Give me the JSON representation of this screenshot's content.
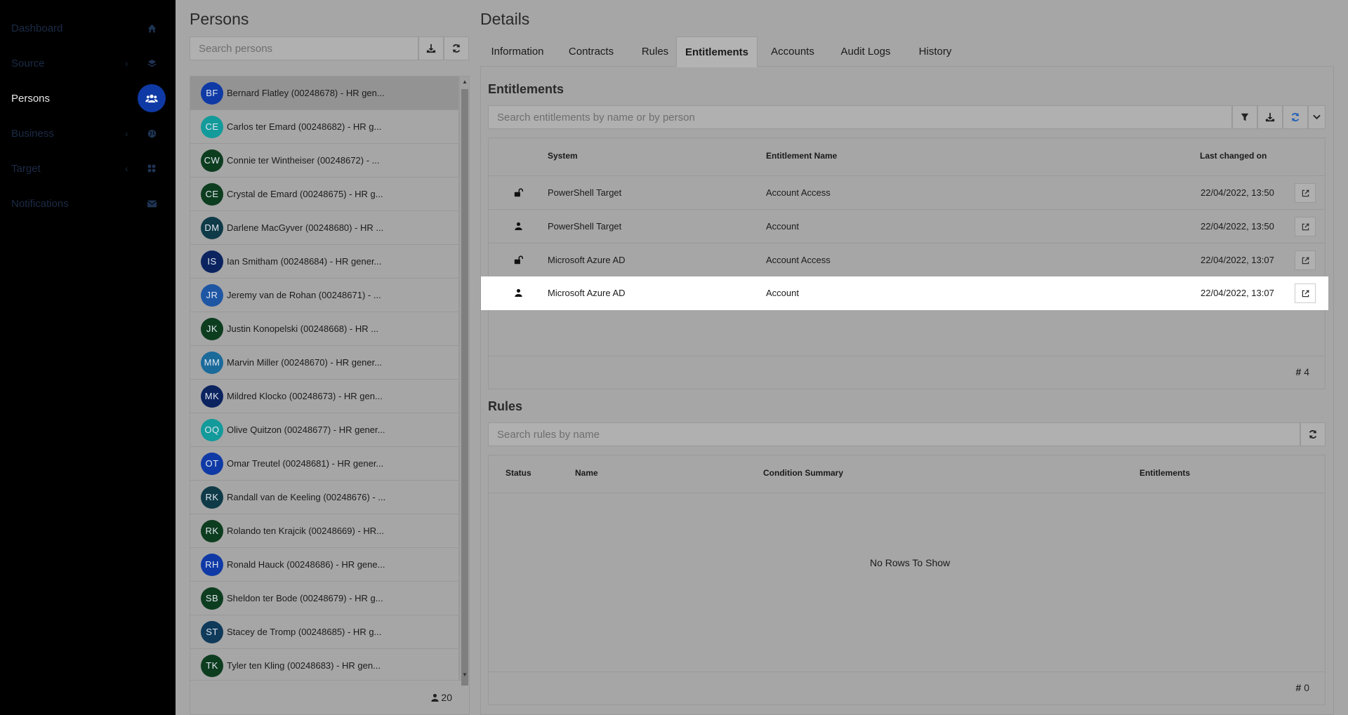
{
  "sidebar": {
    "items": [
      {
        "label": "Dashboard",
        "icon": "home-icon",
        "chevron": ""
      },
      {
        "label": "Source",
        "icon": "layers-icon",
        "chevron": "‹"
      },
      {
        "label": "Persons",
        "icon": "users-icon",
        "chevron": ""
      },
      {
        "label": "Business",
        "icon": "globe-icon",
        "chevron": "‹"
      },
      {
        "label": "Target",
        "icon": "grid-icon",
        "chevron": "‹"
      },
      {
        "label": "Notifications",
        "icon": "envelope-icon",
        "chevron": ""
      }
    ]
  },
  "persons": {
    "title": "Persons",
    "search_placeholder": "Search persons",
    "count": "20",
    "list": [
      {
        "initials": "BF",
        "name": "Bernard Flatley (00248678) - HR gen...",
        "color": "#0f3aa6"
      },
      {
        "initials": "CE",
        "name": "Carlos ter Emard (00248682) - HR g...",
        "color": "#139a9a"
      },
      {
        "initials": "CW",
        "name": "Connie ter Wintheiser (00248672) - ...",
        "color": "#0d3d1f"
      },
      {
        "initials": "CE",
        "name": "Crystal de Emard (00248675) - HR g...",
        "color": "#0d3d1f"
      },
      {
        "initials": "DM",
        "name": "Darlene MacGyver (00248680) - HR ...",
        "color": "#0f3a48"
      },
      {
        "initials": "IS",
        "name": "Ian Smitham (00248684) - HR gener...",
        "color": "#0b2460"
      },
      {
        "initials": "JR",
        "name": "Jeremy van de Rohan (00248671) - ...",
        "color": "#1e56a4"
      },
      {
        "initials": "JK",
        "name": "Justin Konopelski (00248668) - HR ...",
        "color": "#0d3d1f"
      },
      {
        "initials": "MM",
        "name": "Marvin Miller (00248670) - HR gener...",
        "color": "#1a6a9a"
      },
      {
        "initials": "MK",
        "name": "Mildred Klocko (00248673) - HR gen...",
        "color": "#0b2460"
      },
      {
        "initials": "OQ",
        "name": "Olive Quitzon (00248677) - HR gener...",
        "color": "#139a9a"
      },
      {
        "initials": "OT",
        "name": "Omar Treutel (00248681) - HR gener...",
        "color": "#0f3aa6"
      },
      {
        "initials": "RK",
        "name": "Randall van de Keeling (00248676) - ...",
        "color": "#0f3a48"
      },
      {
        "initials": "RK",
        "name": "Rolando ten Krajcik (00248669) - HR...",
        "color": "#0d3d1f"
      },
      {
        "initials": "RH",
        "name": "Ronald Hauck (00248686) - HR gene...",
        "color": "#0f3aa6"
      },
      {
        "initials": "SB",
        "name": "Sheldon ter Bode (00248679) - HR g...",
        "color": "#0d3d1f"
      },
      {
        "initials": "ST",
        "name": "Stacey de Tromp (00248685) - HR g...",
        "color": "#0f3a5a"
      },
      {
        "initials": "TK",
        "name": "Tyler ten Kling (00248683) - HR gen...",
        "color": "#0d3d1f"
      }
    ]
  },
  "details": {
    "title": "Details",
    "tabs": [
      "Information",
      "Contracts",
      "Rules",
      "Entitlements",
      "Accounts",
      "Audit Logs",
      "History"
    ],
    "active_tab": "Entitlements"
  },
  "entitlements": {
    "title": "Entitlements",
    "search_placeholder": "Search entitlements by name or by person",
    "columns": {
      "system": "System",
      "name": "Entitlement Name",
      "changed": "Last changed on"
    },
    "rows": [
      {
        "type": "unlock-icon",
        "system": "PowerShell Target",
        "name": "Account Access",
        "changed": "22/04/2022, 13:50"
      },
      {
        "type": "user-icon",
        "system": "PowerShell Target",
        "name": "Account",
        "changed": "22/04/2022, 13:50"
      },
      {
        "type": "unlock-icon",
        "system": "Microsoft Azure AD",
        "name": "Account Access",
        "changed": "22/04/2022, 13:07"
      },
      {
        "type": "user-icon",
        "system": "Microsoft Azure AD",
        "name": "Account",
        "changed": "22/04/2022, 13:07"
      }
    ],
    "count": "4"
  },
  "rules": {
    "title": "Rules",
    "search_placeholder": "Search rules by name",
    "columns": {
      "status": "Status",
      "name": "Name",
      "condition": "Condition Summary",
      "entitlements": "Entitlements"
    },
    "empty_text": "No Rows To Show",
    "count": "0"
  },
  "colors": {
    "accent": "#0f3aa6",
    "refresh": "#1d5fb8"
  }
}
